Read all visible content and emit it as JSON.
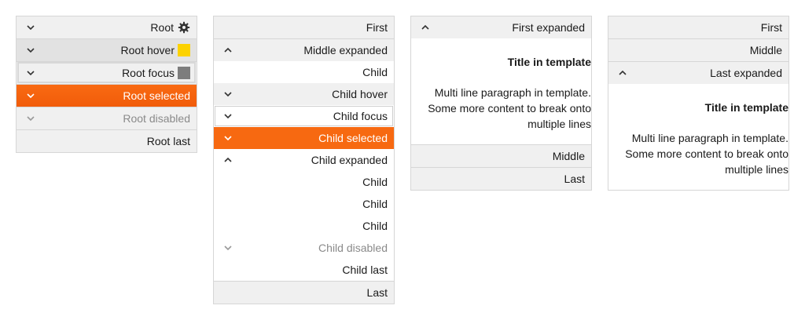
{
  "panel1": {
    "items": [
      {
        "label": "Root"
      },
      {
        "label": "Root hover"
      },
      {
        "label": "Root focus"
      },
      {
        "label": "Root selected"
      },
      {
        "label": "Root disabled"
      },
      {
        "label": "Root last"
      }
    ]
  },
  "panel2": {
    "items": [
      {
        "label": "First"
      },
      {
        "label": "Middle expanded"
      },
      {
        "label": "Child"
      },
      {
        "label": "Child hover"
      },
      {
        "label": "Child focus"
      },
      {
        "label": "Child selected"
      },
      {
        "label": "Child expanded"
      },
      {
        "label": "Child"
      },
      {
        "label": "Child"
      },
      {
        "label": "Child"
      },
      {
        "label": "Child disabled"
      },
      {
        "label": "Child last"
      },
      {
        "label": "Last"
      }
    ]
  },
  "panel3": {
    "items": [
      {
        "label": "First expanded"
      },
      {
        "label": "Middle"
      },
      {
        "label": "Last"
      }
    ],
    "template": {
      "title": "Title in template",
      "paragraph_lines": [
        "Multi line paragraph in template.",
        "Some more content to break onto",
        "multiple lines"
      ]
    }
  },
  "panel4": {
    "items": [
      {
        "label": "First"
      },
      {
        "label": "Middle"
      },
      {
        "label": "Last expanded"
      }
    ],
    "template": {
      "title": "Title in template",
      "paragraph_lines": [
        "Multi line paragraph in template.",
        "Some more content to break onto",
        "multiple lines"
      ]
    }
  },
  "colors": {
    "selected": "#f76911",
    "hover": "#e2e2e2",
    "header": "#f0f0f0",
    "border": "#d6d6d6",
    "swatch_yellow": "#fcd200",
    "swatch_gray": "#7d7d7d"
  },
  "icons": {
    "expand": "chevron-down-icon",
    "collapse": "chevron-up-icon",
    "settings": "gear-icon"
  }
}
